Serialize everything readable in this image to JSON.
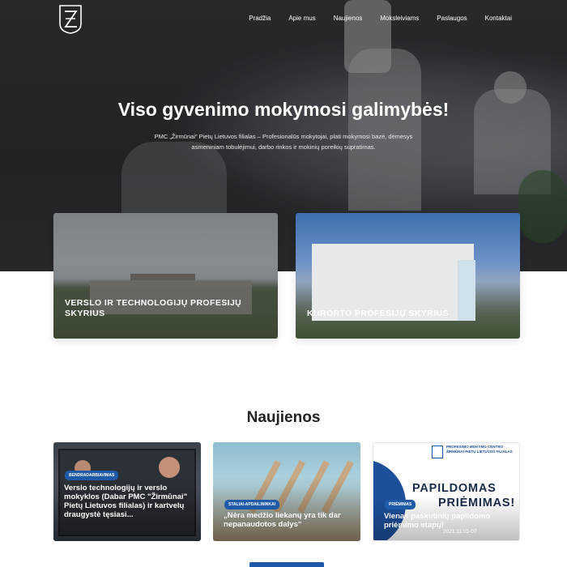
{
  "brand": {
    "logo_icon": "zirmunai-logo-icon",
    "accent": "#1e5aa8"
  },
  "nav": {
    "items": [
      "Pradžia",
      "Apie mus",
      "Naujienos",
      "Moksleiviams",
      "Paslaugos",
      "Kontaktai"
    ]
  },
  "hero": {
    "title": "Viso gyvenimo mokymosi galimybės!",
    "subtitle": "PMC „Žirmūnai“ Pietų Lietuvos filialas – Profesionalūs mokytojai, plati mokymosi bazė, dėmesys asmeniniam tobulėjimui, darbo rinkos ir mokinių poreikių supratimas."
  },
  "departments": [
    {
      "label": "Verslo ir technologijų profesijų skyrius"
    },
    {
      "label": "Kurorto profesijų skyrius"
    }
  ],
  "news": {
    "heading": "Naujienos",
    "items": [
      {
        "badge": "Bendradarbiavimas",
        "title": "Verslo technologijų ir verslo mokyklos (Dabar PMC \"Žirmūnai\" Pietų Lietuvos filialas) ir kartvelų draugystė tęsiasi..."
      },
      {
        "badge": "Staliai-apdailininkai",
        "title": "„Nėra medžio liekanų yra tik dar nepanaudotos dalys“"
      },
      {
        "badge": "Priėmimas",
        "title": "Vienas paskutinių papildomo priėmimo etapų!",
        "date": "2021.11.01-07",
        "org_text": "Profesinio mokymo centro Žirmūnai Pietų Lietuvos filialas",
        "promo_line1": "PAPILDOMAS",
        "promo_line2": "PRIĖMIMAS!"
      }
    ]
  }
}
